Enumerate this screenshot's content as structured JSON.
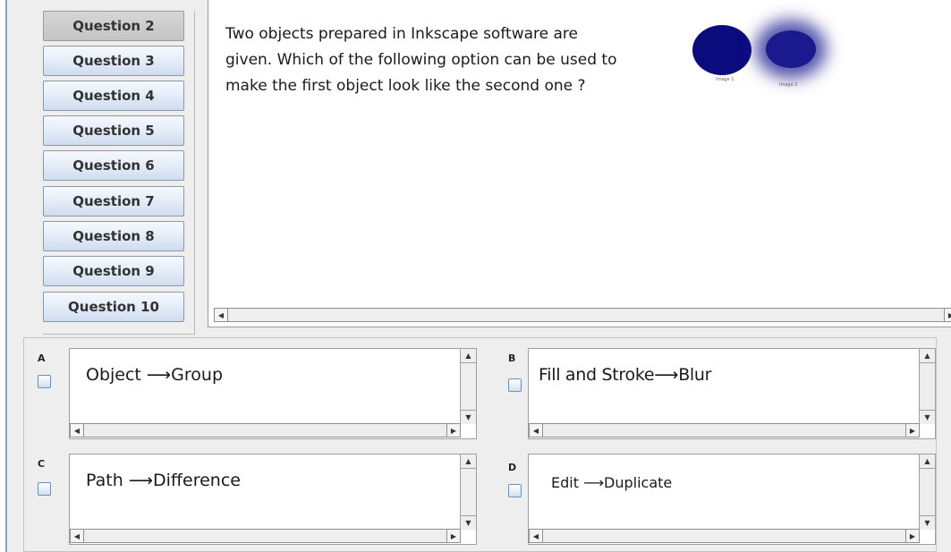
{
  "questions": {
    "active_index": 0,
    "items": [
      "Question 2",
      "Question 3",
      "Question 4",
      "Question 5",
      "Question 6",
      "Question 7",
      "Question 8",
      "Question 9",
      "Question 10"
    ]
  },
  "question": {
    "line1": "Two objects prepared in Inkscape software are",
    "line2": "given. Which of the following option can be used to",
    "line3": "make the first object look like the second  one ?",
    "image1_caption": "Image 1",
    "image2_caption": "Image 2"
  },
  "options": {
    "a": {
      "letter": "A",
      "text": "Object ⟶Group",
      "checked": false
    },
    "b": {
      "letter": "B",
      "text": "Fill and Stroke⟶Blur",
      "checked": false
    },
    "c": {
      "letter": "C",
      "text": "Path ⟶Difference",
      "checked": false
    },
    "d": {
      "letter": "D",
      "text": "Edit ⟶Duplicate",
      "checked": false
    }
  },
  "icons": {
    "scroll_left": "arrow-left-icon",
    "scroll_right": "arrow-right-icon",
    "scroll_up": "arrow-up-icon",
    "scroll_down": "arrow-down-icon"
  },
  "colors": {
    "image1_fill": "#0b0b7e",
    "image2_fill": "#1a1a8e",
    "nav_button": "#dce6f4",
    "nav_button_active": "#cccccc"
  }
}
